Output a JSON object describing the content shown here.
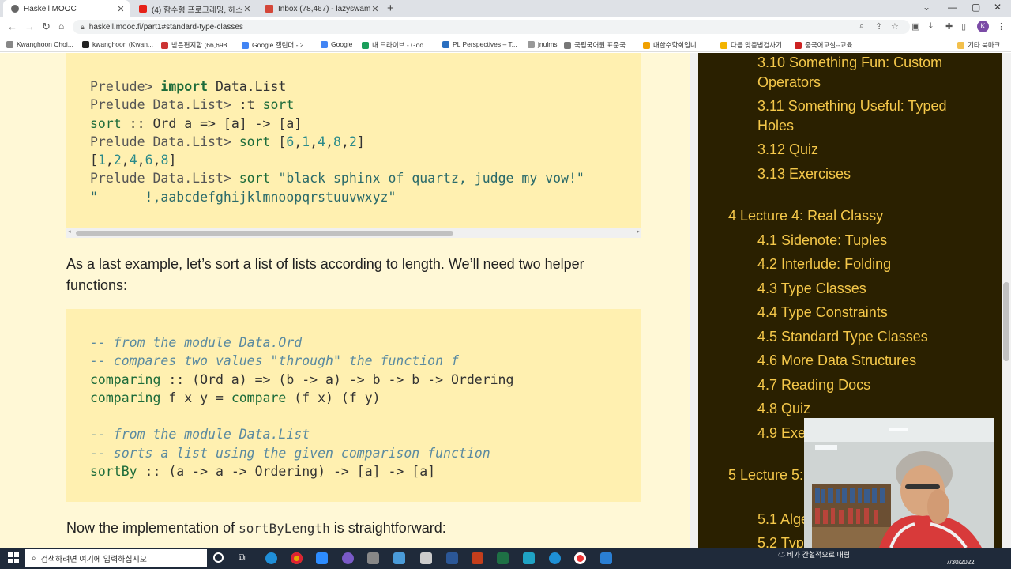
{
  "browser": {
    "tabs": [
      {
        "title": "Haskell MOOC",
        "active": true
      },
      {
        "title": "(4) 함수형 프로그래밍, 하스켈 | ..."
      },
      {
        "title": "Inbox (78,467) - lazyswamp@g..."
      }
    ],
    "url": "haskell.mooc.fi/part1#standard-type-classes",
    "profile_initial": "K",
    "bookmarks": [
      "Kwanghoon Choi...",
      "kwanghoon (Kwan...",
      "받은편지함 (66,698...",
      "Google 캘린더 - 2...",
      "Google",
      "내 드라이브 - Goo...",
      "PL Perspectives – T...",
      "jnulms",
      "국립국어원 표준국...",
      "대한수학회입니...",
      "다음 맞춤법검사기",
      "중국어교실--교육...",
      "기타 북마크"
    ]
  },
  "content": {
    "ghci": [
      {
        "prompt": "Prelude> ",
        "kw": "import",
        "rest": " Data.List"
      },
      {
        "prompt": "Prelude Data.List> ",
        "rest": ":t sort"
      },
      {
        "rest": "sort :: Ord a => [a] -> [a]"
      },
      {
        "prompt": "Prelude Data.List> ",
        "rest": "sort [6,1,4,8,2]"
      },
      {
        "rest": "[1,2,4,6,8]"
      },
      {
        "prompt": "Prelude Data.List> ",
        "rest": "sort \"black sphinx of quartz, judge my vow!\""
      },
      {
        "rest": "\"      !,aabcdefghijklmnoopqrstuuvwxyz\""
      }
    ],
    "para1": "As a last example, let’s sort a list of lists according to length. We’ll need two helper functions:",
    "code2": [
      "-- from the module Data.Ord",
      "-- compares two values \"through\" the function f",
      "comparing :: (Ord a) => (b -> a) -> b -> b -> Ordering",
      "comparing f x y = compare (f x) (f y)",
      "",
      "-- from the module Data.List",
      "-- sorts a list using the given comparison function",
      "sortBy :: (a -> a -> Ordering) -> [a] -> [a]"
    ],
    "para2_before": "Now the implementation of ",
    "para2_code": "sortByLength",
    "para2_after": " is straightforward:"
  },
  "sidebar": {
    "items": [
      {
        "text": "3.10 Something Fun: Custom Operators",
        "level": 2
      },
      {
        "text": "3.11 Something Useful: Typed Holes",
        "level": 2
      },
      {
        "text": "3.12 Quiz",
        "level": 2
      },
      {
        "text": "3.13 Exercises",
        "level": 2
      },
      {
        "text": "4 Lecture 4: Real Classy",
        "level": 1
      },
      {
        "text": "4.1 Sidenote: Tuples",
        "level": 2
      },
      {
        "text": "4.2 Interlude: Folding",
        "level": 2
      },
      {
        "text": "4.3 Type Classes",
        "level": 2
      },
      {
        "text": "4.4 Type Constraints",
        "level": 2
      },
      {
        "text": "4.5 Standard Type Classes",
        "level": 2
      },
      {
        "text": "4.6 More Data Structures",
        "level": 2
      },
      {
        "text": "4.7 Reading Docs",
        "level": 2
      },
      {
        "text": "4.8 Quiz",
        "level": 2
      },
      {
        "text": "4.9 Exercises",
        "level": 2
      },
      {
        "text": "5 Lecture 5: Tying the Knot",
        "level": 1
      },
      {
        "text": "5.1 Algebraic Datatypes",
        "level": 2
      },
      {
        "text": "5.2 Type Parameters",
        "level": 2
      }
    ]
  },
  "taskbar": {
    "search_placeholder": "검색하려면 여기에 입력하십시오",
    "tray_text": "비가 간헐적으로 내림",
    "date": "7/30/2022"
  },
  "colors": {
    "page_bg": "#fff8d6",
    "code_bg": "#fff0b0",
    "sidebar_bg": "#2a2000",
    "sidebar_text": "#f5c84a"
  }
}
